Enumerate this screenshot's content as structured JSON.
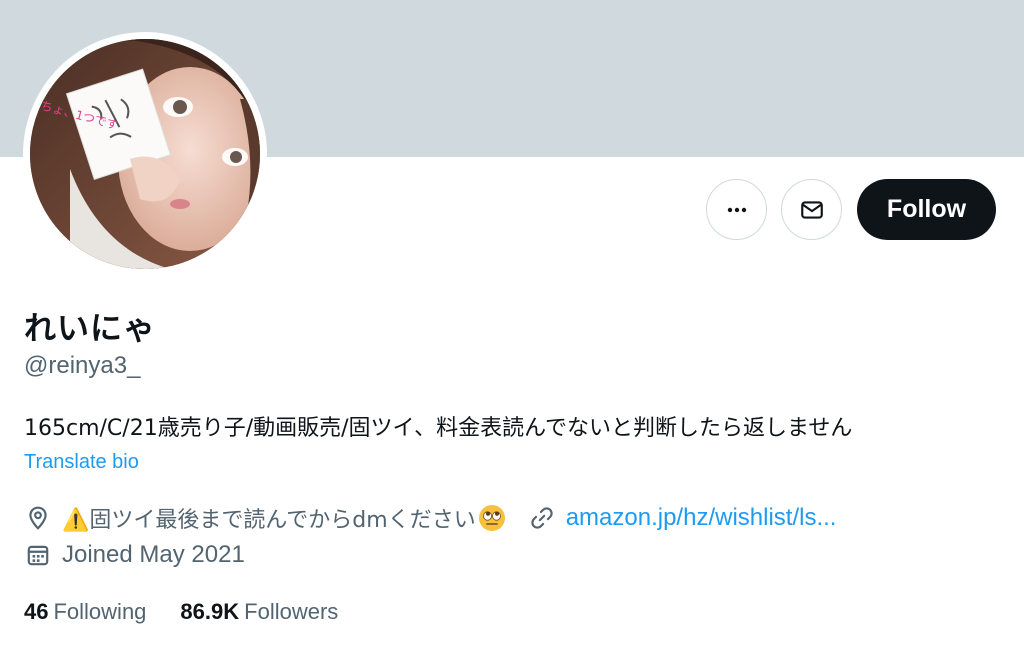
{
  "profile": {
    "display_name": "れいにゃ",
    "handle": "@reinya3_",
    "bio": "165cm/C/21歳売り子/動画販売/固ツイ、料金表読んでないと判断したら返しません",
    "translate_label": "Translate bio",
    "location": "⚠️固ツイ最後まで読んでからdmください",
    "location_emoji": "face-with-rolling-eyes",
    "website": "amazon.jp/hz/wishlist/ls...",
    "joined": "Joined May 2021",
    "avatar_note_text": "ちょ、1つです"
  },
  "actions": {
    "more_icon": "more-horizontal-icon",
    "message_icon": "envelope-icon",
    "follow_label": "Follow"
  },
  "stats": {
    "following_count": "46",
    "following_label": "Following",
    "followers_count": "86.9K",
    "followers_label": "Followers"
  },
  "colors": {
    "banner": "#cfd9de",
    "accent_link": "#1d9bf0",
    "text_primary": "#0f1419",
    "text_secondary": "#536471",
    "follow_button_bg": "#0f1419"
  }
}
